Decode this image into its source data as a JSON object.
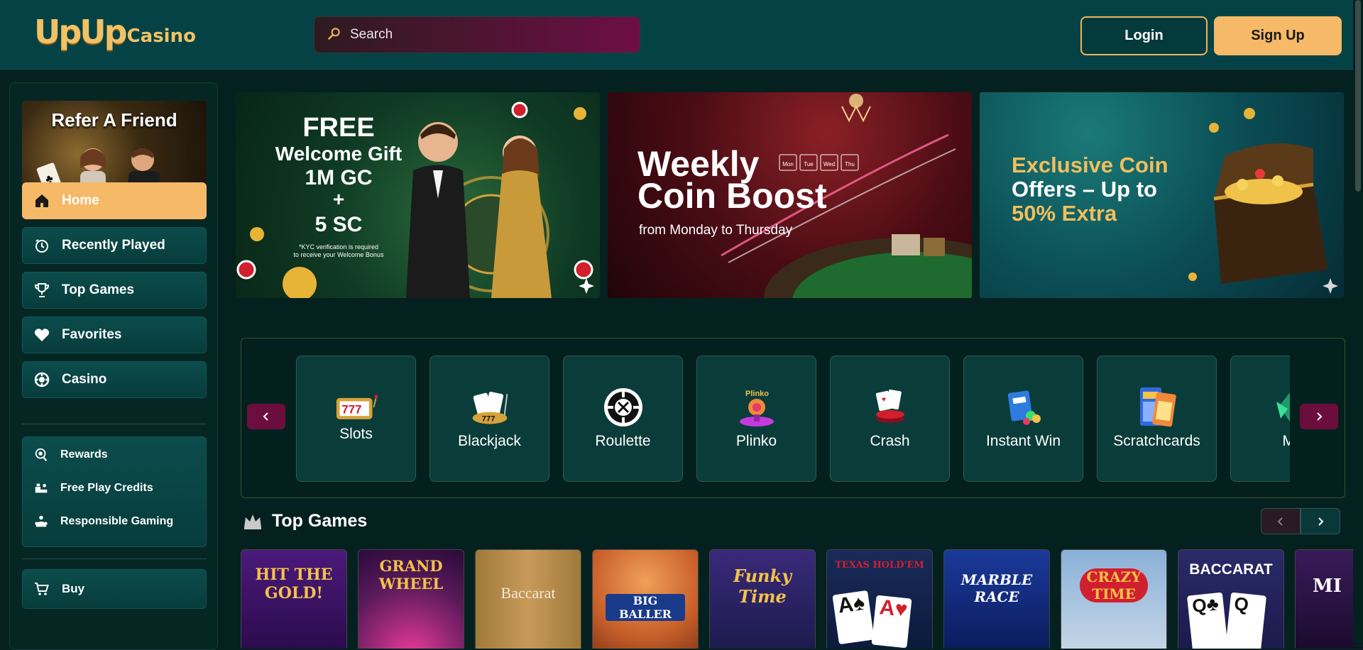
{
  "header": {
    "logo_main": "UpUp",
    "logo_sub": "Casino",
    "search_placeholder": "Search",
    "login_label": "Login",
    "signup_label": "Sign Up"
  },
  "sidebar": {
    "promo_title": "Refer A Friend",
    "nav": [
      {
        "label": "Home",
        "icon": "home-icon"
      },
      {
        "label": "Recently Played",
        "icon": "recent-icon"
      },
      {
        "label": "Top Games",
        "icon": "trophy-icon"
      },
      {
        "label": "Favorites",
        "icon": "heart-icon"
      },
      {
        "label": "Casino",
        "icon": "casino-chip-icon"
      }
    ],
    "sub": [
      {
        "label": "Rewards",
        "icon": "rewards-icon"
      },
      {
        "label": "Free Play Credits",
        "icon": "free-play-icon"
      },
      {
        "label": "Responsible Gaming",
        "icon": "responsible-gaming-icon"
      }
    ],
    "buy_label": "Buy"
  },
  "banners": {
    "b1": {
      "line1": "FREE",
      "line2": "Welcome Gift",
      "line3": "1M GC",
      "line4": "+",
      "line5": "5 SC",
      "note1": "*KYC verification is required",
      "note2": "to receive your Welcome Bonus"
    },
    "b2": {
      "line1": "Weekly",
      "line2": "Coin Boost",
      "sub": "from Monday to Thursday",
      "days": [
        "Mon",
        "Tue",
        "Wed",
        "Thu"
      ]
    },
    "b3": {
      "line1": "Exclusive Coin",
      "line2": "Offers – Up to",
      "line3": "50% Extra"
    }
  },
  "categories": [
    {
      "label": "Slots",
      "icon": "slots-icon"
    },
    {
      "label": "Blackjack",
      "icon": "blackjack-icon"
    },
    {
      "label": "Roulette",
      "icon": "roulette-icon"
    },
    {
      "label": "Plinko",
      "icon": "plinko-icon"
    },
    {
      "label": "Crash",
      "icon": "crash-icon"
    },
    {
      "label": "Instant Win",
      "icon": "instant-win-icon"
    },
    {
      "label": "Scratchcards",
      "icon": "scratchcards-icon"
    },
    {
      "label": "Mi",
      "icon": "misc-icon"
    }
  ],
  "top_games": {
    "title": "Top Games",
    "games": [
      "HIT THE GOLD!",
      "GRAND WHEEL",
      "Baccarat",
      "BIG BALLER",
      "Funky Time",
      "TEXAS HOLD'EM",
      "MARBLE RACE",
      "CRAZY TIME",
      "BACCARAT",
      "MI"
    ]
  },
  "colors": {
    "accent": "#f6b967",
    "header": "#054245",
    "bg": "#05211f",
    "arrow": "#6b0e3e"
  }
}
